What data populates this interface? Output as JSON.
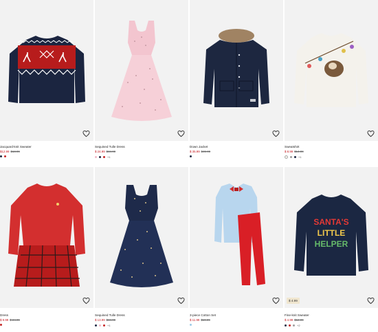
{
  "products": [
    {
      "name": "Jacquard-knit Sweater",
      "sale_price": "$12.99",
      "regular_price": "$18.99",
      "swatches": [
        "#1f2a44",
        "#c62828"
      ],
      "more": "",
      "badge": "",
      "heart": "heart-outline"
    },
    {
      "name": "Sequined Tulle Dress",
      "sale_price": "$ 24.99",
      "regular_price": "$34.99",
      "swatches": [
        "#f2b8c6",
        "#1f2a44",
        "#c62828"
      ],
      "more": "+1",
      "badge": "",
      "heart": "heart-outline"
    },
    {
      "name": "Down Jacket",
      "sale_price": "$ 35.99",
      "regular_price": "$49.99",
      "swatches": [
        "#1f2a44"
      ],
      "more": "",
      "badge": "",
      "heart": "heart-outline"
    },
    {
      "name": "Sweatshirt",
      "sale_price": "$ 8.99",
      "regular_price": "$14.99",
      "swatches": [
        "#f5f2ea",
        "#9e9e9e",
        "#1f2a44"
      ],
      "more": "+1",
      "badge": "",
      "heart": "heart-outline"
    },
    {
      "name": "Dress",
      "sale_price": "$ 9.99",
      "regular_price": "$ 24.99",
      "swatches": [
        "#c62828"
      ],
      "more": "",
      "badge": "",
      "heart": "heart-outline"
    },
    {
      "name": "Sequined Tulle Dress",
      "sale_price": "$ 13.99",
      "regular_price": "$34.99",
      "swatches": [
        "#1f2a44",
        "#f2b8c6",
        "#c62828"
      ],
      "more": "+1",
      "badge": "",
      "heart": "heart-outline"
    },
    {
      "name": "3-piece Cotton Set",
      "sale_price": "$ 11.99",
      "regular_price": "$19.99",
      "swatches": [
        "#9ecbe8"
      ],
      "more": "",
      "badge": "",
      "heart": "heart-outline"
    },
    {
      "name": "Fine-knit Sweater",
      "sale_price": "$ 4.99",
      "regular_price": "$12.99",
      "swatches": [
        "#1f2a44",
        "#c62828",
        "#9e9e9e"
      ],
      "more": "+2",
      "badge": "$ 4.99",
      "heart": "heart-outline"
    }
  ],
  "graphics": {
    "jumper_text_1": "SANTA'S",
    "jumper_text_2": "LITTLE",
    "jumper_text_3": "HELPER",
    "jacket_label": "H&M"
  }
}
